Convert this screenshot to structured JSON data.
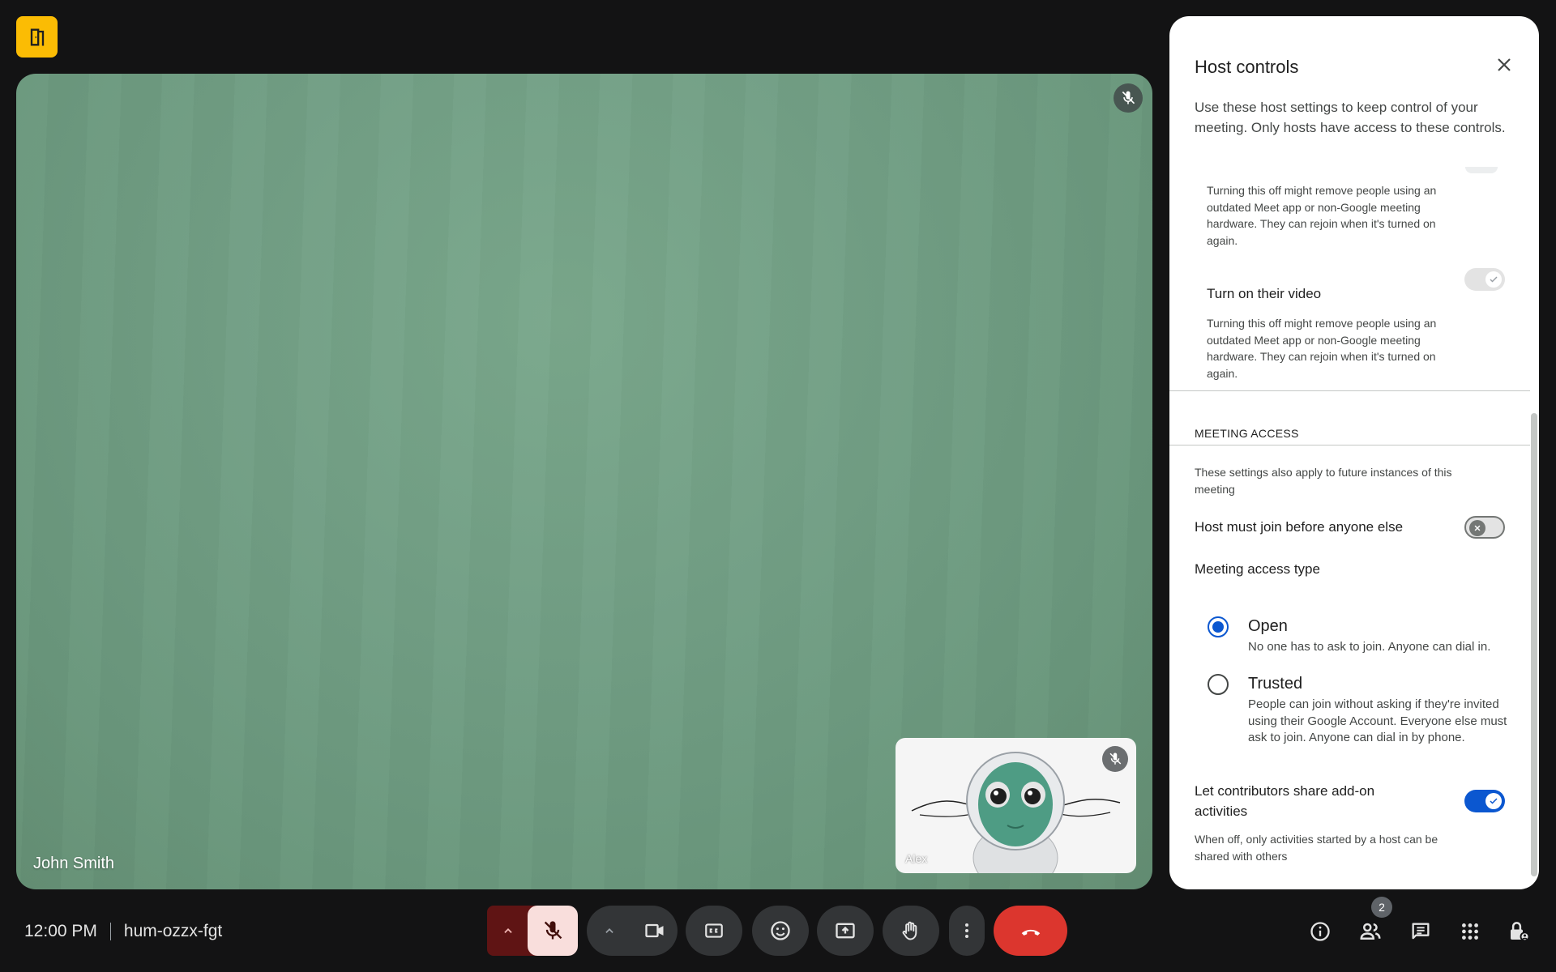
{
  "meeting": {
    "time": "12:00 PM",
    "code": "hum-ozzx-fgt"
  },
  "stage": {
    "participant_name": "John Smith"
  },
  "self_view": {
    "participant_name": "Alex"
  },
  "host_controls": {
    "title": "Host controls",
    "intro": "Use these host settings to keep control of your meeting. Only hosts have access to these controls.",
    "audio_desc": "Turning this off might remove people using an outdated Meet app or non-Google meeting hardware. They can rejoin when it's turned on again.",
    "video_label": "Turn on their video",
    "video_desc": "Turning this off might remove people using an outdated Meet app or non-Google meeting hardware. They can rejoin when it's turned on again.",
    "access_section": "MEETING ACCESS",
    "access_note": "These settings also apply to future instances of this meeting",
    "host_first_label": "Host must join before anyone else",
    "access_type_label": "Meeting access type",
    "open_label": "Open",
    "open_desc": "No one has to ask to join. Anyone can dial in.",
    "trusted_label": "Trusted",
    "trusted_desc": "People can join without asking if they're invited using their Google Account. Everyone else must ask to join. Anyone can dial in by phone.",
    "addon_label": "Let contributors share add-on activities",
    "addon_desc": "When off, only activities started by a host can be shared with others"
  },
  "people_count": "2",
  "colors": {
    "background": "#131314",
    "accent_blue": "#0b57d0",
    "end_call_red": "#dc362e",
    "mic_muted_bg": "#f9dedc",
    "badge_yellow": "#fbbc04"
  },
  "icons": {
    "top_badge": "door-icon",
    "mic": "mic-off-icon",
    "camera": "videocam-icon",
    "captions": "closed-caption-icon",
    "emoji": "emoji-icon",
    "present": "present-to-all-icon",
    "hand": "raise-hand-icon",
    "more": "more-vert-icon",
    "end": "call-end-icon",
    "info": "info-icon",
    "people": "people-icon",
    "chat": "chat-icon",
    "activities": "apps-icon",
    "host": "host-lock-icon"
  }
}
